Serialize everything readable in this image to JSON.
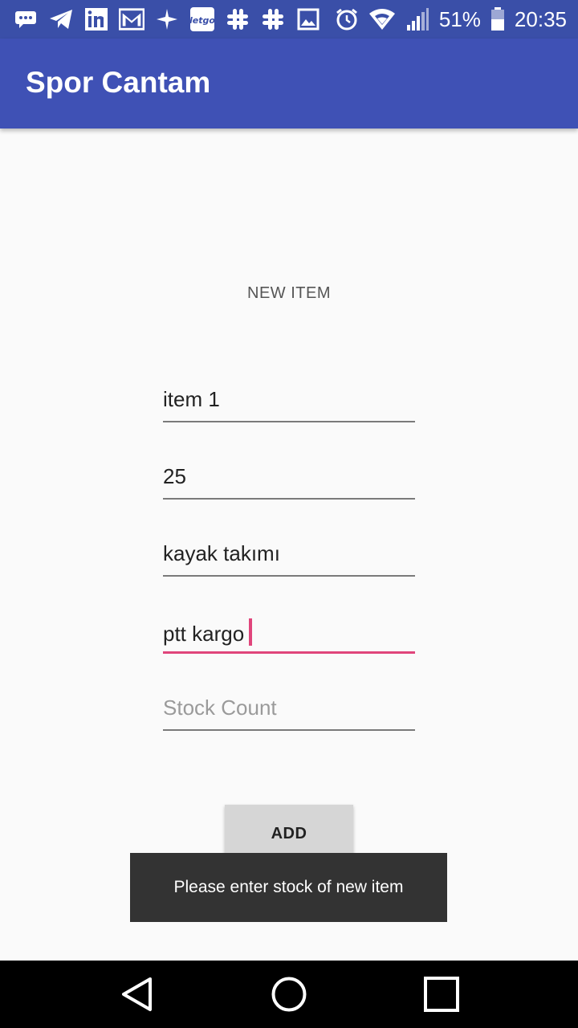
{
  "status_bar": {
    "left_icons": [
      "chat-bubble-icon",
      "telegram-icon",
      "linkedin-icon",
      "gmail-icon",
      "flight-icon",
      "letgo-icon",
      "slack-icon",
      "slack-icon",
      "image-icon"
    ],
    "battery": "51%",
    "time": "20:35"
  },
  "app_bar": {
    "title": "Spor Cantam"
  },
  "form": {
    "section_label": "NEW ITEM",
    "fields": [
      {
        "value": "item 1"
      },
      {
        "value": "25"
      },
      {
        "value": "kayak takımı"
      },
      {
        "value": "ptt kargo"
      },
      {
        "placeholder": "Stock Count",
        "value": ""
      }
    ],
    "add_button_label": "ADD"
  },
  "toast": {
    "message": "Please enter stock of new item"
  },
  "colors": {
    "status_bar": "#3a4fa8",
    "app_bar": "#3f51b5",
    "accent": "#e0457b",
    "toast_bg": "#333333"
  }
}
